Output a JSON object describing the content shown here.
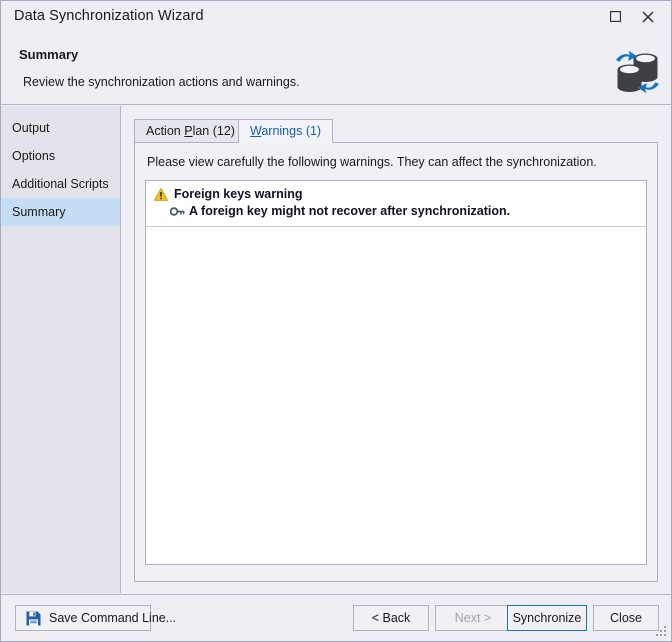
{
  "window": {
    "title": "Data Synchronization Wizard",
    "buttons": {
      "maximize": "maximize-icon",
      "close": "close-icon"
    }
  },
  "header": {
    "title": "Summary",
    "subtitle": "Review the synchronization actions and warnings.",
    "icon": "database-sync-icon"
  },
  "sidebar": {
    "items": [
      {
        "label": "Output",
        "selected": false
      },
      {
        "label": "Options",
        "selected": false
      },
      {
        "label": "Additional Scripts",
        "selected": false
      },
      {
        "label": "Summary",
        "selected": true
      }
    ]
  },
  "tabs": [
    {
      "label_pre": "Action ",
      "label_mnemonic": "P",
      "label_post": "lan (12)",
      "active": false
    },
    {
      "label_pre": "",
      "label_mnemonic": "W",
      "label_post": "arnings (1)",
      "active": true
    }
  ],
  "panel": {
    "intro": "Please view carefully the following warnings. They can affect the synchronization.",
    "warnings": [
      {
        "icon": "warning-triangle-icon",
        "title": "Foreign keys warning",
        "rows": [
          {
            "icon": "key-icon",
            "text": "A foreign key might not recover after synchronization."
          }
        ]
      }
    ]
  },
  "footer": {
    "save_command_line": "Save Command Line...",
    "save_icon": "floppy-save-icon",
    "back": "< Back",
    "next": "Next >",
    "synchronize": "Synchronize",
    "close": "Close"
  },
  "colors": {
    "window_bg": "#eeeef4",
    "sidebar_bg": "#e3e3eb",
    "selection": "#c5dcf5",
    "accent_blue": "#1560a8",
    "warning_yellow": "#f5c020",
    "focus_border": "#1773bd",
    "disabled_text": "#a3a3ae"
  }
}
